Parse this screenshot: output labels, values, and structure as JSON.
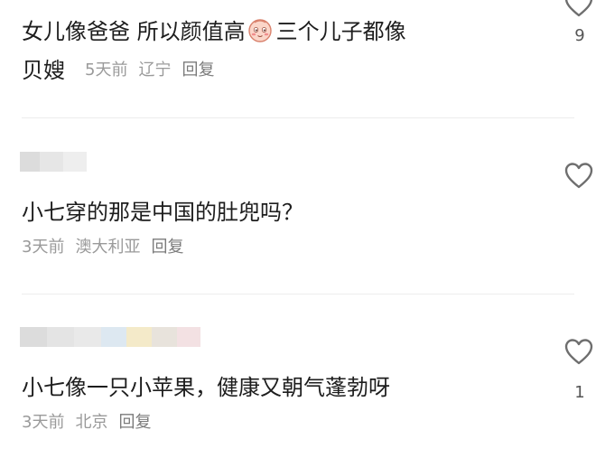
{
  "comments": [
    {
      "text_part1": "女儿像爸爸 所以颜值高",
      "emoji": "blushing-face-emoji",
      "text_part2": "三个儿子都像",
      "text_line2": "贝嫂",
      "time": "5天前",
      "location": "辽宁",
      "reply": "回复",
      "like_count": "9"
    },
    {
      "text": "小七穿的那是中国的肚兜吗？",
      "time": "3天前",
      "location": "澳大利亚",
      "reply": "回复",
      "like_count": ""
    },
    {
      "text": "小七像一只小苹果，健康又朝气蓬勃呀",
      "time": "3天前",
      "location": "北京",
      "reply": "回复",
      "like_count": "1"
    }
  ],
  "colors": {
    "text": "#1d1d1d",
    "meta": "#9a9a9a",
    "heart_outline": "#6e6e6e"
  }
}
